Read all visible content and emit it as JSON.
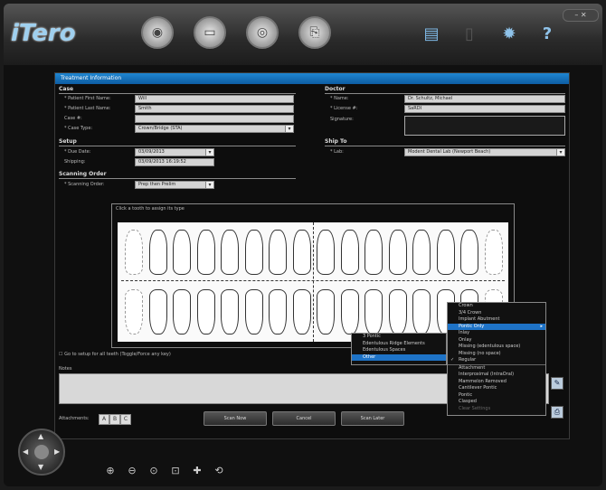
{
  "app": {
    "logo": "iTero"
  },
  "toolbar": {
    "nav_icons": [
      "info-icon",
      "scanner-icon",
      "eye-icon",
      "export-icon"
    ],
    "right_icons": [
      "document-icon",
      "trash-icon",
      "gear-icon",
      "help-icon"
    ],
    "window_controls": "–  ✕"
  },
  "dialog": {
    "title": "Treatment Information",
    "case": {
      "heading": "Case",
      "patient_first_label": "* Patient First Name:",
      "patient_first_value": "Will",
      "patient_last_label": "* Patient Last Name:",
      "patient_last_value": "Smith",
      "case_no_label": "Case #:",
      "case_no_value": "",
      "case_type_label": "* Case Type:",
      "case_type_value": "Crown/Bridge (STA)"
    },
    "doctor": {
      "heading": "Doctor",
      "name_label": "* Name:",
      "name_value": "Dr. Schultz, Michael",
      "license_label": "* License #:",
      "license_value": "SaRDI",
      "signature_label": "Signature:"
    },
    "setup": {
      "heading": "Setup",
      "due_date_label": "* Due Date:",
      "due_date_value": "03/09/2013",
      "shipping_label": "Shipping:",
      "shipping_value": "03/09/2013 16:19:52"
    },
    "ship_to": {
      "heading": "Ship To",
      "lab_label": "* Lab:",
      "lab_value": "Modent Dental Lab (Newport Beach)"
    },
    "scanning": {
      "heading": "Scanning Order",
      "order_label": "* Scanning Order:",
      "order_value": "Prep then Prelim"
    },
    "chart_title": "Click a tooth to assign its type",
    "checkbox_label": "Go to setup for all teeth (Toggle/Force any key)",
    "notes_label": "Notes",
    "attachments_label": "Attachments:",
    "attach_buttons": [
      "A",
      "B",
      "C"
    ],
    "buttons": {
      "scan": "Scan Now",
      "cancel": "Cancel",
      "scan_later": "Scan Later"
    },
    "side_icons": [
      "notes-icon",
      "attachment-icon"
    ]
  },
  "context_menu": {
    "items": [
      {
        "label": "Crown",
        "state": ""
      },
      {
        "label": "3/4 Crown",
        "state": ""
      },
      {
        "label": "Implant Abutment",
        "state": ""
      },
      {
        "label": "Pontic Only",
        "state": "hl",
        "arrow": "▸"
      },
      {
        "label": "Inlay",
        "state": ""
      },
      {
        "label": "Onlay",
        "state": ""
      },
      {
        "label": "Missing (edentulous space)",
        "state": ""
      },
      {
        "label": "Missing (no space)",
        "state": ""
      },
      {
        "label": "Regular",
        "state": "checked",
        "check": "✓"
      },
      {
        "label": "Attachment",
        "state": "sep"
      },
      {
        "label": "Interproximal (IntraOral)",
        "state": ""
      },
      {
        "label": "Mammelon Removed",
        "state": ""
      },
      {
        "label": "Cantilever Pontic",
        "state": ""
      },
      {
        "label": "Pontic",
        "state": ""
      },
      {
        "label": "Clasped",
        "state": ""
      },
      {
        "label": "Clear Settings",
        "state": "dis"
      }
    ]
  },
  "submenu": {
    "items": [
      {
        "label": "3 Pontic",
        "state": ""
      },
      {
        "label": "Edentulous Ridge Elements",
        "state": ""
      },
      {
        "label": "Edentulous Spaces",
        "state": ""
      },
      {
        "label": "Other",
        "state": "hl"
      }
    ]
  },
  "bottom": {
    "zoom_icons": [
      "zoom-in-icon",
      "zoom-out-icon",
      "zoom-fit-icon",
      "zoom-window-icon",
      "pan-icon",
      "rotate-icon"
    ],
    "zoom_glyphs": [
      "⊕",
      "⊖",
      "⊙",
      "⊡",
      "✚",
      "⟲"
    ]
  }
}
